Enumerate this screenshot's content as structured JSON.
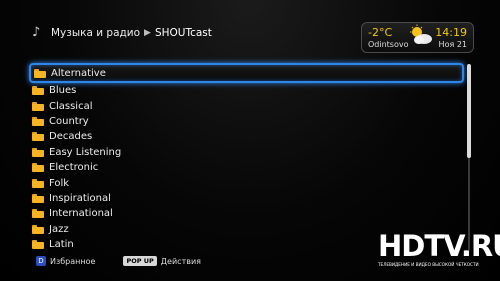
{
  "breadcrumb": {
    "section": "Музыка и радио",
    "current": "SHOUTcast"
  },
  "weather": {
    "temperature": "-2°C",
    "city": "Odintsovo",
    "time": "14:19",
    "date": "Ноя 21",
    "icon": "partly-cloudy-icon"
  },
  "list": {
    "items": [
      "Alternative",
      "Blues",
      "Classical",
      "Country",
      "Decades",
      "Easy Listening",
      "Electronic",
      "Folk",
      "Inspirational",
      "International",
      "Jazz",
      "Latin"
    ],
    "selected_index": 0
  },
  "footer": {
    "favorites_key": "D",
    "favorites_label": "Избранное",
    "popup_key": "POP UP",
    "actions_label": "Действия"
  },
  "logo": {
    "main": "HDTV.RU",
    "sub": "ТЕЛЕВИДЕНИЕ И ВИДЕО ВЫСОКОЙ ЧЕТКОСТИ"
  },
  "colors": {
    "accent_blue": "#2f86e8",
    "highlight_yellow": "#f2c900",
    "folder": "#f6b425"
  }
}
